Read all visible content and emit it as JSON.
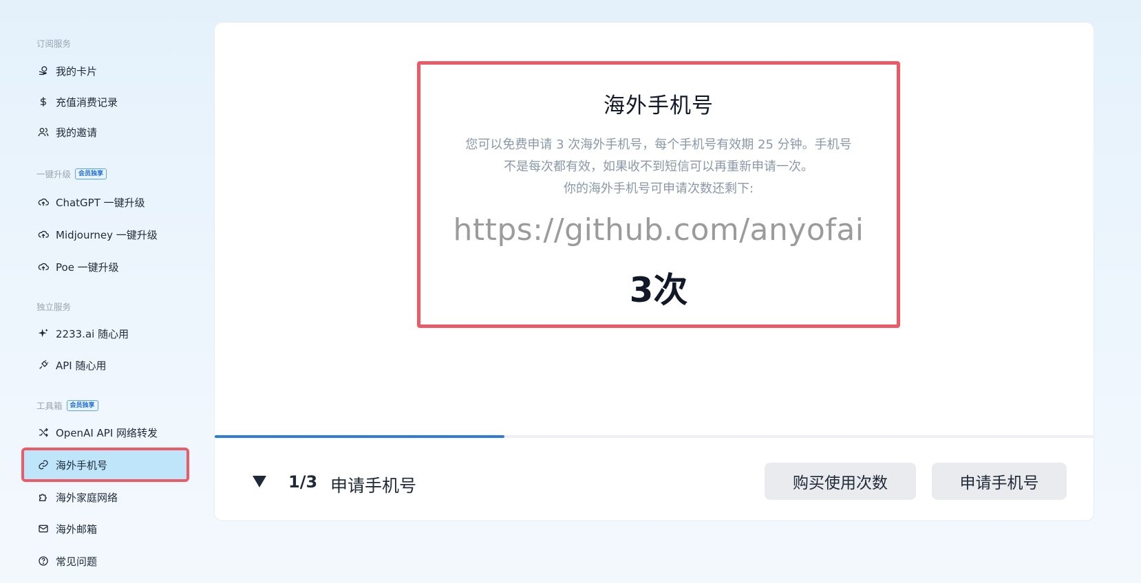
{
  "sidebar": {
    "sections": [
      {
        "title": "订阅服务",
        "badge": "",
        "items": [
          {
            "label": "我的卡片",
            "icon": "coins-icon"
          },
          {
            "label": "充值消费记录",
            "icon": "dollar-icon"
          },
          {
            "label": "我的邀请",
            "icon": "users-icon"
          }
        ]
      },
      {
        "title": "一键升级",
        "badge": "会员独享",
        "items": [
          {
            "label": "ChatGPT 一键升级",
            "icon": "cloud-upload-icon"
          },
          {
            "label": "Midjourney 一键升级",
            "icon": "cloud-upload-icon"
          },
          {
            "label": "Poe 一键升级",
            "icon": "cloud-upload-icon"
          }
        ]
      },
      {
        "title": "独立服务",
        "badge": "",
        "items": [
          {
            "label": "2233.ai 随心用",
            "icon": "sparkle-icon"
          },
          {
            "label": "API 随心用",
            "icon": "plug-icon"
          }
        ]
      },
      {
        "title": "工具箱",
        "badge": "会员独享",
        "items": [
          {
            "label": "OpenAI API 网络转发",
            "icon": "shuffle-icon"
          },
          {
            "label": "海外手机号",
            "icon": "link-icon",
            "active": true
          },
          {
            "label": "海外家庭网络",
            "icon": "puzzle-icon"
          },
          {
            "label": "海外邮箱",
            "icon": "mail-icon"
          },
          {
            "label": "常见问题",
            "icon": "help-circle-icon"
          }
        ]
      }
    ]
  },
  "main": {
    "info": {
      "title": "海外手机号",
      "desc_line1": "您可以免费申请 3 次海外手机号，每个手机号有效期 25 分钟。手机号",
      "desc_line2": "不是每次都有效，如果收不到短信可以再重新申请一次。",
      "desc_line3": "你的海外手机号可申请次数还剩下:",
      "watermark": "https://github.com/anyofai",
      "count": "3次"
    },
    "progress": 0.33,
    "step": {
      "counter": "1/3",
      "label": "申请手机号"
    },
    "buttons": {
      "buy": "购买使用次数",
      "apply": "申请手机号"
    }
  },
  "colors": {
    "accent": "#2f7ce0",
    "highlight_border": "#ec5a66",
    "active_bg": "#bfe5fb"
  }
}
